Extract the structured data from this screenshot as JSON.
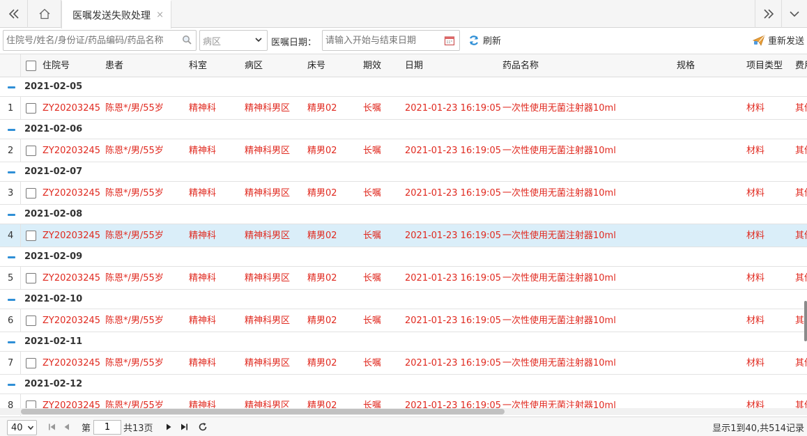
{
  "tabs": {
    "active_tab_label": "医嘱发送失败处理",
    "close_glyph": "×"
  },
  "toolbar": {
    "search_placeholder": "住院号/姓名/身份证/药品编码/药品名称",
    "ward_placeholder": "病区",
    "date_label": "医嘱日期：",
    "date_placeholder": "请输入开始与结束日期",
    "refresh_label": "刷新",
    "resend_label": "重新发送"
  },
  "grid": {
    "columns": [
      "住院号",
      "患者",
      "科室",
      "病区",
      "床号",
      "期效",
      "日期",
      "药品名称",
      "规格",
      "项目类型",
      "费用"
    ],
    "groups": [
      {
        "date": "2021-02-05",
        "row": {
          "n": "1",
          "id": "ZY20203245",
          "patient": "陈恩*/男/55岁",
          "dept": "精神科",
          "ward": "精神科男区",
          "bed": "精男02",
          "term": "长嘱",
          "time": "2021-01-23 16:19:05",
          "drug": "一次性使用无菌注射器10ml",
          "spec": "",
          "type": "材料",
          "fee": "其他"
        }
      },
      {
        "date": "2021-02-06",
        "row": {
          "n": "2",
          "id": "ZY20203245",
          "patient": "陈恩*/男/55岁",
          "dept": "精神科",
          "ward": "精神科男区",
          "bed": "精男02",
          "term": "长嘱",
          "time": "2021-01-23 16:19:05",
          "drug": "一次性使用无菌注射器10ml",
          "spec": "",
          "type": "材料",
          "fee": "其他"
        }
      },
      {
        "date": "2021-02-07",
        "row": {
          "n": "3",
          "id": "ZY20203245",
          "patient": "陈恩*/男/55岁",
          "dept": "精神科",
          "ward": "精神科男区",
          "bed": "精男02",
          "term": "长嘱",
          "time": "2021-01-23 16:19:05",
          "drug": "一次性使用无菌注射器10ml",
          "spec": "",
          "type": "材料",
          "fee": "其他"
        }
      },
      {
        "date": "2021-02-08",
        "row": {
          "n": "4",
          "id": "ZY20203245",
          "patient": "陈恩*/男/55岁",
          "dept": "精神科",
          "ward": "精神科男区",
          "bed": "精男02",
          "term": "长嘱",
          "time": "2021-01-23 16:19:05",
          "drug": "一次性使用无菌注射器10ml",
          "spec": "",
          "type": "材料",
          "fee": "其他"
        }
      },
      {
        "date": "2021-02-09",
        "row": {
          "n": "5",
          "id": "ZY20203245",
          "patient": "陈恩*/男/55岁",
          "dept": "精神科",
          "ward": "精神科男区",
          "bed": "精男02",
          "term": "长嘱",
          "time": "2021-01-23 16:19:05",
          "drug": "一次性使用无菌注射器10ml",
          "spec": "",
          "type": "材料",
          "fee": "其他"
        }
      },
      {
        "date": "2021-02-10",
        "row": {
          "n": "6",
          "id": "ZY20203245",
          "patient": "陈恩*/男/55岁",
          "dept": "精神科",
          "ward": "精神科男区",
          "bed": "精男02",
          "term": "长嘱",
          "time": "2021-01-23 16:19:05",
          "drug": "一次性使用无菌注射器10ml",
          "spec": "",
          "type": "材料",
          "fee": "其他"
        }
      },
      {
        "date": "2021-02-11",
        "row": {
          "n": "7",
          "id": "ZY20203245",
          "patient": "陈恩*/男/55岁",
          "dept": "精神科",
          "ward": "精神科男区",
          "bed": "精男02",
          "term": "长嘱",
          "time": "2021-01-23 16:19:05",
          "drug": "一次性使用无菌注射器10ml",
          "spec": "",
          "type": "材料",
          "fee": "其他"
        }
      },
      {
        "date": "2021-02-12",
        "row": {
          "n": "8",
          "id": "ZY20203245",
          "patient": "陈恩*/男/55岁",
          "dept": "精神科",
          "ward": "精神科男区",
          "bed": "精男02",
          "term": "长嘱",
          "time": "2021-01-23 16:19:05",
          "drug": "一次性使用无菌注射器10ml",
          "spec": "",
          "type": "材料",
          "fee": "其他"
        }
      }
    ],
    "selected_row": "4"
  },
  "pager": {
    "page_size": "40",
    "page_prefix": "第",
    "current_page": "1",
    "page_suffix": "共13页",
    "info": "显示1到40,共514记录"
  },
  "colors": {
    "row_text": "#e0291f",
    "selected_bg": "#daeef9",
    "accent": "#2f8fd6"
  }
}
